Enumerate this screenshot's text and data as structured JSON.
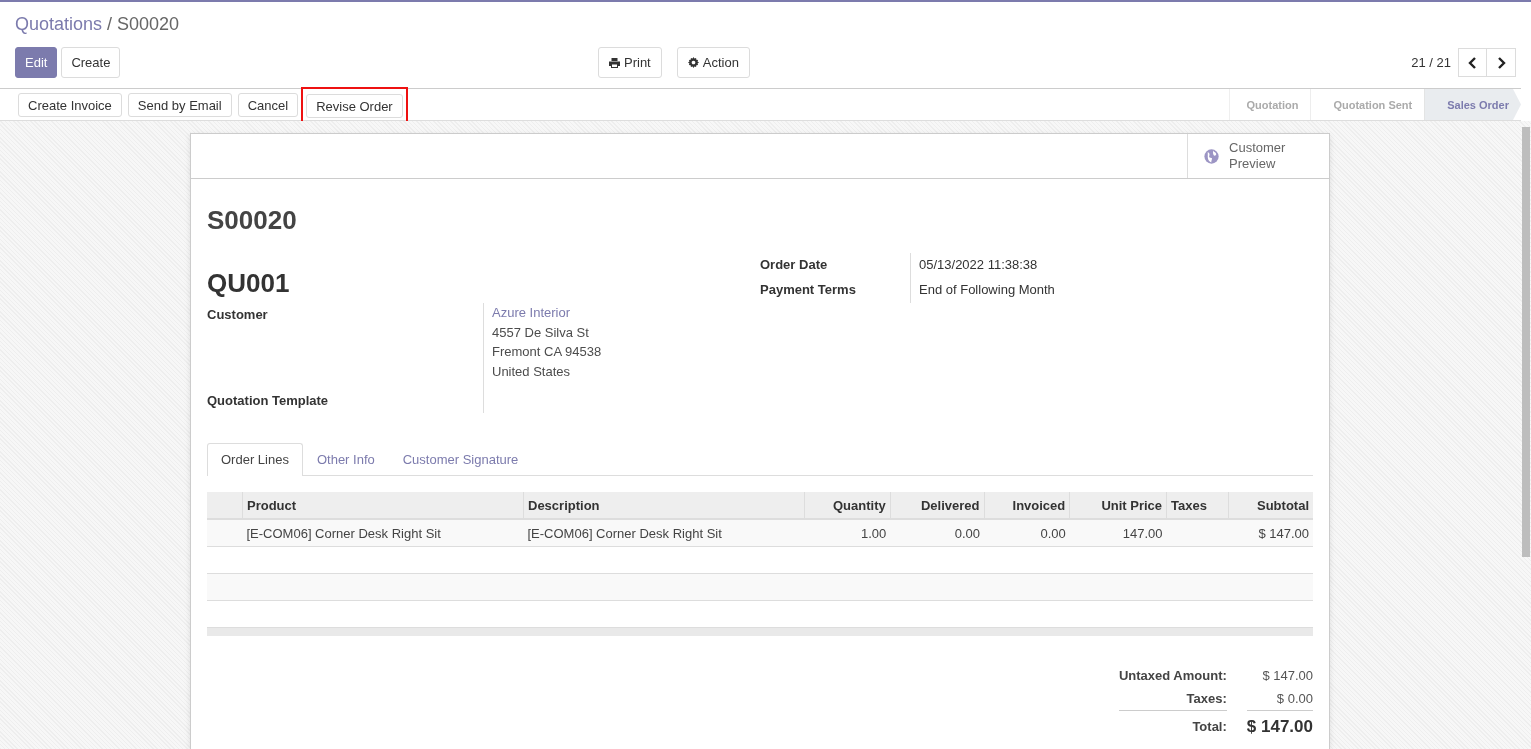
{
  "breadcrumb": {
    "parent": "Quotations",
    "separator": "/",
    "current": "S00020"
  },
  "main_buttons": [
    {
      "label": "Edit",
      "primary": true
    },
    {
      "label": "Create",
      "primary": false
    }
  ],
  "center_buttons": [
    {
      "label": "Print",
      "kind": "print"
    },
    {
      "label": "Action",
      "kind": "gear"
    }
  ],
  "pager": "21 / 21",
  "action_buttons": [
    {
      "label": "Create Invoice",
      "highlighted": false
    },
    {
      "label": "Send by Email",
      "highlighted": false
    },
    {
      "label": "Cancel",
      "highlighted": false
    },
    {
      "label": "Revise Order",
      "highlighted": true
    }
  ],
  "stages": [
    {
      "label": "Quotation",
      "selected": false
    },
    {
      "label": "Quotation Sent",
      "selected": false
    },
    {
      "label": "Sales Order",
      "selected": true
    }
  ],
  "customer_preview": "Customer Preview",
  "order_name": "S00020",
  "quote_ref": "QU001",
  "customer_label": "Customer",
  "customer_name": "Azure Interior",
  "customer_address": [
    "4557 De Silva St",
    "Fremont CA 94538",
    "United States"
  ],
  "template_label": "Quotation Template",
  "right_fields": [
    {
      "label": "Order Date",
      "value": "05/13/2022 11:38:38"
    },
    {
      "label": "Payment Terms",
      "value": "End of Following Month"
    }
  ],
  "tabs": [
    {
      "label": "Order Lines",
      "selected": true
    },
    {
      "label": "Other Info",
      "selected": false
    },
    {
      "label": "Customer Signature",
      "selected": false
    }
  ],
  "table": {
    "columns": [
      "Product",
      "Description",
      "Quantity",
      "Delivered",
      "Invoiced",
      "Unit Price",
      "Taxes",
      "Subtotal"
    ],
    "rows": [
      [
        "[E-COM06] Corner Desk Right Sit",
        "[E-COM06] Corner Desk Right Sit",
        "1.00",
        "0.00",
        "0.00",
        "147.00",
        "",
        "$ 147.00"
      ]
    ]
  },
  "totals": [
    {
      "label": "Untaxed Amount:",
      "value": "$ 147.00",
      "kind": "line"
    },
    {
      "label": "Taxes:",
      "value": "$ 0.00",
      "kind": "line"
    },
    {
      "label": "Total:",
      "value": "$ 147.00",
      "kind": "total"
    }
  ]
}
